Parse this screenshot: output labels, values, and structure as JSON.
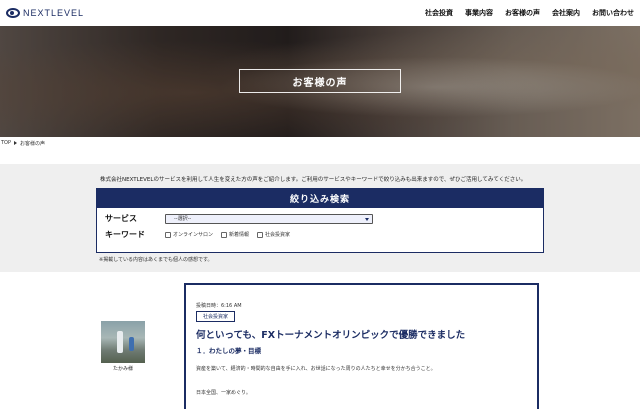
{
  "header": {
    "logo_text": "NEXTLEVEL",
    "nav": [
      "社会投資",
      "事業内容",
      "お客様の声",
      "会社案内",
      "お問い合わせ"
    ]
  },
  "hero": {
    "title": "お客様の声"
  },
  "breadcrumb": {
    "home": "TOP",
    "current": "お客様の声"
  },
  "search": {
    "intro": "株式会社NEXTLEVELのサービスを利用して人生を変えた方の声をご紹介します。ご利用のサービスやキーワードで絞り込みも出来ますので、ぜひご活用してみてください。",
    "heading": "絞り込み検索",
    "service_label": "サービス",
    "service_selected": "--選択--",
    "keyword_label": "キーワード",
    "keywords": [
      "オンラインサロン",
      "新着情報",
      "社会投資家"
    ],
    "note": "※掲載している内容はあくまでも個人の感想です。"
  },
  "testimonial": {
    "name": "たかみ様",
    "date": "投稿日時：6:16 AM",
    "tag": "社会投資家",
    "title": "何といっても、FXトーナメントオリンピックで優勝できました",
    "subtitle": "１．わたしの夢・目標",
    "body1": "資産を築いて、経済的・時間的な自由を手に入れ、お世話になった周りの人たちと幸せを分かち合うこと。",
    "body2": "日本全国、一家めぐり。"
  },
  "colors": {
    "brand": "#1b2c63",
    "section_bg": "#efefef"
  }
}
